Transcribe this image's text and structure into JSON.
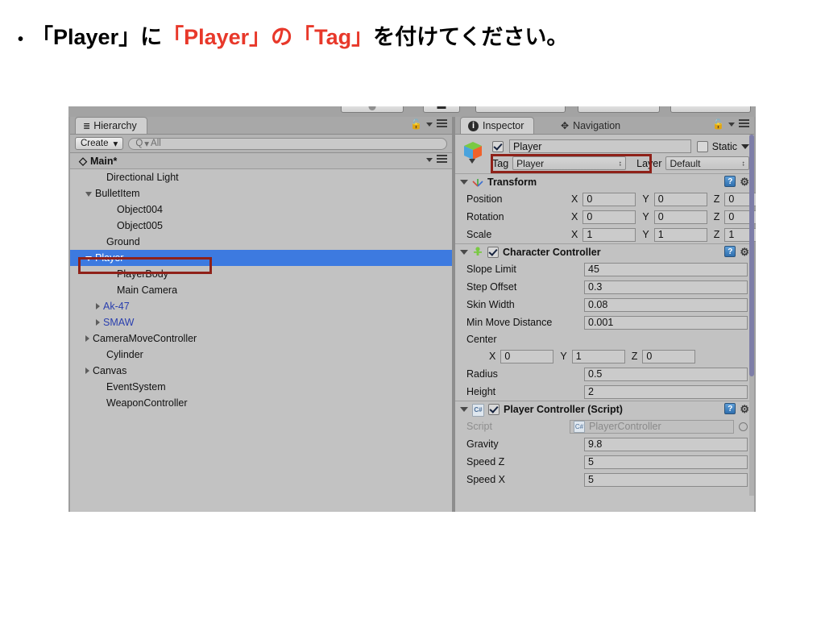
{
  "slide": {
    "bullet": "•",
    "text_part1": "「Player」に",
    "text_highlight": "「Player」の「Tag」",
    "text_part2": "を付けてください。",
    "highlight_color": "#e8382a"
  },
  "hierarchy": {
    "tab_label": "Hierarchy",
    "tab_icon": "list-icon",
    "create_button": "Create",
    "create_caret": "▾",
    "search_prefix": "Q",
    "search_caret": "▾",
    "search_placeholder": "All",
    "scene_name": "Main*",
    "scene_icon": "unity-scene-icon",
    "lock_icon": "lock-icon",
    "menu_icon": "hamburger-menu-icon",
    "items": [
      {
        "label": "Directional Light",
        "indent": 2,
        "arrow": "none",
        "blue": false,
        "selected": false
      },
      {
        "label": "BulletItem",
        "indent": 1,
        "arrow": "open",
        "blue": false,
        "selected": false
      },
      {
        "label": "Object004",
        "indent": 3,
        "arrow": "none",
        "blue": false,
        "selected": false
      },
      {
        "label": "Object005",
        "indent": 3,
        "arrow": "none",
        "blue": false,
        "selected": false
      },
      {
        "label": "Ground",
        "indent": 2,
        "arrow": "none",
        "blue": false,
        "selected": false
      },
      {
        "label": "Player",
        "indent": 1,
        "arrow": "open",
        "blue": false,
        "selected": true
      },
      {
        "label": "PlayerBody",
        "indent": 3,
        "arrow": "none",
        "blue": false,
        "selected": false
      },
      {
        "label": "Main Camera",
        "indent": 3,
        "arrow": "none",
        "blue": false,
        "selected": false
      },
      {
        "label": "Ak-47",
        "indent": 2,
        "arrow": "closed",
        "blue": true,
        "selected": false
      },
      {
        "label": "SMAW",
        "indent": 2,
        "arrow": "closed",
        "blue": true,
        "selected": false
      },
      {
        "label": "CameraMoveController",
        "indent": 1,
        "arrow": "closed",
        "blue": false,
        "selected": false
      },
      {
        "label": "Cylinder",
        "indent": 2,
        "arrow": "none",
        "blue": false,
        "selected": false
      },
      {
        "label": "Canvas",
        "indent": 1,
        "arrow": "closed",
        "blue": false,
        "selected": false
      },
      {
        "label": "EventSystem",
        "indent": 2,
        "arrow": "none",
        "blue": false,
        "selected": false
      },
      {
        "label": "WeaponController",
        "indent": 2,
        "arrow": "none",
        "blue": false,
        "selected": false
      }
    ]
  },
  "inspector": {
    "tab_label": "Inspector",
    "tab_icon": "info-icon",
    "nav_tab_label": "Navigation",
    "nav_tab_icon": "navigation-arrows-icon",
    "lock_icon": "lock-icon",
    "menu_icon": "hamburger-menu-icon",
    "gameobject": {
      "icon": "gameobject-cube-icon",
      "enabled": true,
      "name": "Player",
      "static_label": "Static",
      "static_checked": false,
      "tag_label": "Tag",
      "tag_value": "Player",
      "layer_label": "Layer",
      "layer_value": "Default"
    },
    "components": [
      {
        "title": "Transform",
        "icon": "transform-axis-icon",
        "has_checkbox": false,
        "help_icon": "help-icon",
        "gear_icon": "gear-icon",
        "vector_rows": [
          {
            "label": "Position",
            "x": "0",
            "y": "0",
            "z": "0"
          },
          {
            "label": "Rotation",
            "x": "0",
            "y": "0",
            "z": "0"
          },
          {
            "label": "Scale",
            "x": "1",
            "y": "1",
            "z": "1"
          }
        ]
      },
      {
        "title": "Character Controller",
        "icon": "character-controller-icon",
        "has_checkbox": true,
        "checked": true,
        "help_icon": "help-icon",
        "gear_icon": "gear-icon",
        "rows": [
          {
            "label": "Slope Limit",
            "value": "45"
          },
          {
            "label": "Step Offset",
            "value": "0.3"
          },
          {
            "label": "Skin Width",
            "value": "0.08"
          },
          {
            "label": "Min Move Distance",
            "value": "0.001"
          }
        ],
        "center_label": "Center",
        "center": {
          "x": "0",
          "y": "1",
          "z": "0"
        },
        "rows_after": [
          {
            "label": "Radius",
            "value": "0.5"
          },
          {
            "label": "Height",
            "value": "2"
          }
        ]
      },
      {
        "title": "Player Controller (Script)",
        "icon": "csharp-script-icon",
        "has_checkbox": true,
        "checked": true,
        "help_icon": "help-icon",
        "gear_icon": "gear-icon",
        "script_label": "Script",
        "script_value": "PlayerController",
        "rows": [
          {
            "label": "Gravity",
            "value": "9.8"
          },
          {
            "label": "Speed Z",
            "value": "5"
          },
          {
            "label": "Speed X",
            "value": "5"
          }
        ]
      }
    ]
  },
  "colors": {
    "selection_blue": "#3d7ae0",
    "highlight_box": "#8f2119",
    "panel_gray": "#c2c2c2",
    "prefab_blue": "#2a3fae"
  }
}
